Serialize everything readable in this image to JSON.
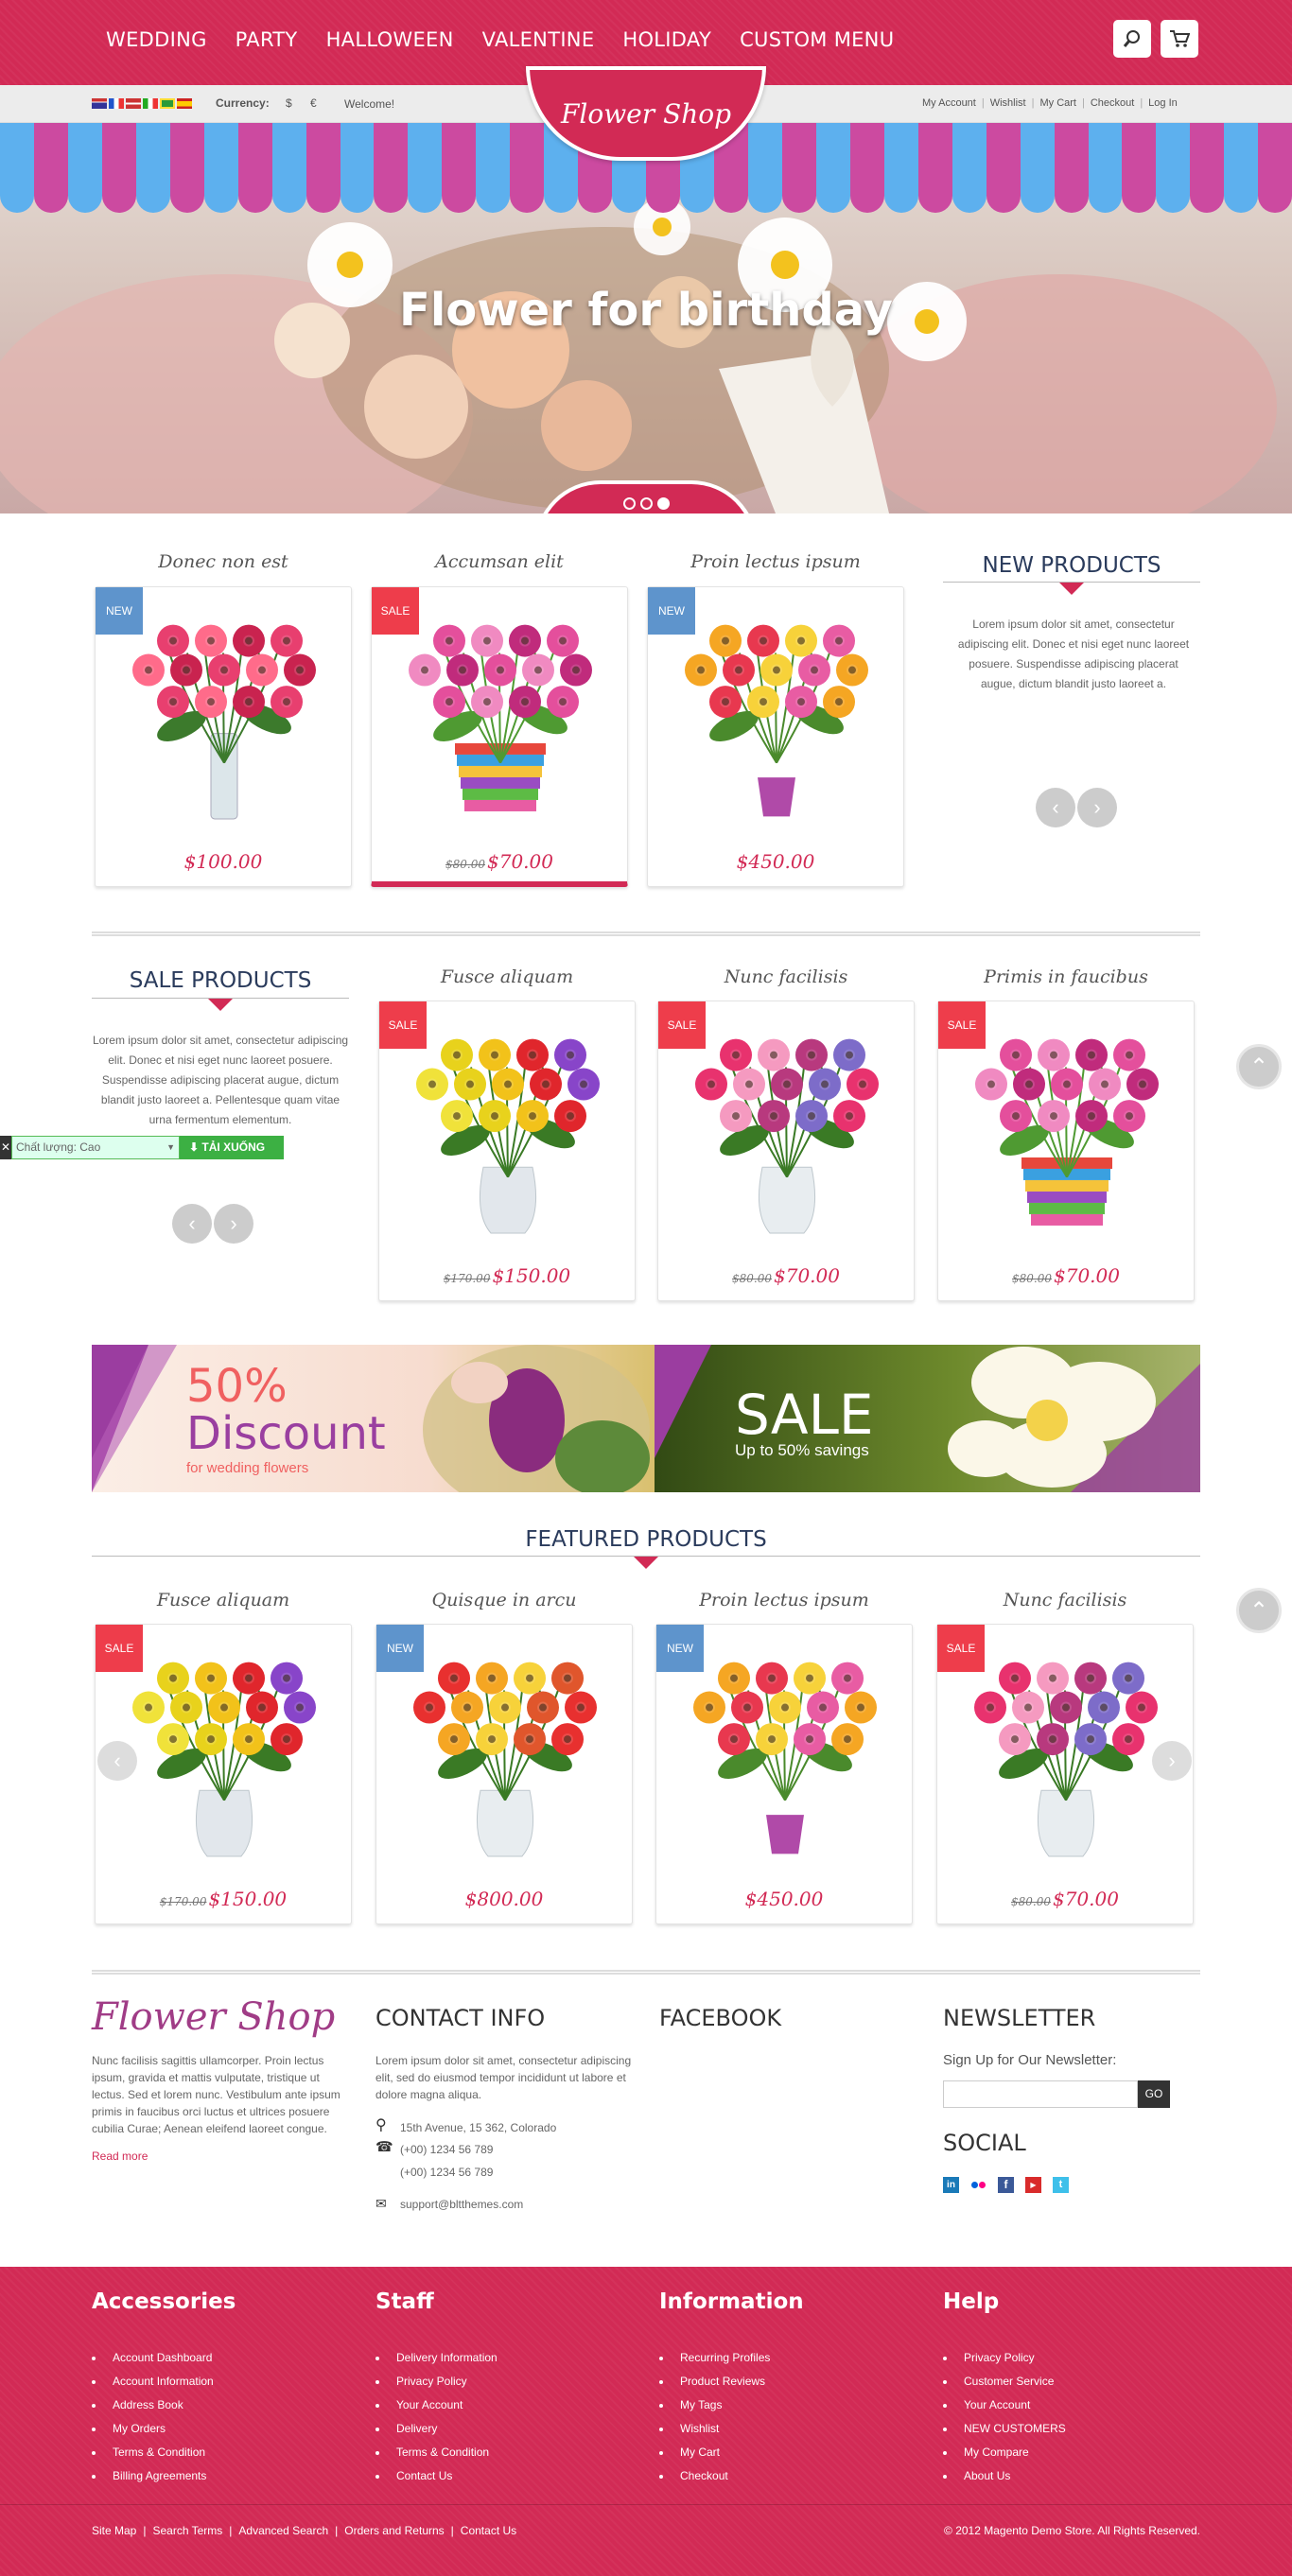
{
  "nav": {
    "menu": [
      "WEDDING",
      "PARTY",
      "HALLOWEEN",
      "VALENTINE",
      "HOLIDAY",
      "CUSTOM MENU"
    ]
  },
  "subbar": {
    "currency_label": "Currency:",
    "currencies": [
      "$",
      "€"
    ],
    "welcome": "Welcome!",
    "links": [
      "My Account",
      "Wishlist",
      "My Cart",
      "Checkout",
      "Log In"
    ]
  },
  "logo": "Flower Shop",
  "hero": {
    "title": "Flower for birthday"
  },
  "new_products": {
    "title": "NEW PRODUCTS",
    "text": "Lorem ipsum dolor sit amet, consectetur adipiscing elit. Donec et nisi eget nunc laoreet posuere. Suspendisse adipiscing placerat augue, dictum blandit justo laoreet a.",
    "items": [
      {
        "name": "Donec non est",
        "tag": "NEW",
        "price": "$100.00",
        "old": ""
      },
      {
        "name": "Accumsan elit",
        "tag": "SALE",
        "price": "$70.00",
        "old": "$80.00"
      },
      {
        "name": "Proin lectus ipsum",
        "tag": "NEW",
        "price": "$450.00",
        "old": ""
      }
    ]
  },
  "sale_products": {
    "title": "SALE PRODUCTS",
    "text": "Lorem ipsum dolor sit amet, consectetur adipiscing elit. Donec et nisi eget nunc laoreet posuere. Suspendisse adipiscing placerat augue, dictum blandit justo laoreet a. Pellentesque quam vitae urna fermentum elementum.",
    "items": [
      {
        "name": "Fusce aliquam",
        "tag": "SALE",
        "price": "$150.00",
        "old": "$170.00"
      },
      {
        "name": "Nunc facilisis",
        "tag": "SALE",
        "price": "$70.00",
        "old": "$80.00"
      },
      {
        "name": "Primis in faucibus",
        "tag": "SALE",
        "price": "$70.00",
        "old": "$80.00"
      }
    ]
  },
  "download_widget": {
    "quality": "Chất lượng: Cao",
    "button": "TẢI XUỐNG"
  },
  "banner": {
    "left_big": "50%",
    "left_word": "Discount",
    "left_small": "for wedding flowers",
    "right_big": "SALE",
    "right_small": "Up to 50% savings"
  },
  "featured": {
    "title": "FEATURED PRODUCTS",
    "items": [
      {
        "name": "Fusce aliquam",
        "tag": "SALE",
        "price": "$150.00",
        "old": "$170.00"
      },
      {
        "name": "Quisque in arcu",
        "tag": "NEW",
        "price": "$800.00",
        "old": ""
      },
      {
        "name": "Proin lectus ipsum",
        "tag": "NEW",
        "price": "$450.00",
        "old": ""
      },
      {
        "name": "Nunc facilisis",
        "tag": "SALE",
        "price": "$70.00",
        "old": "$80.00"
      }
    ]
  },
  "footer_top": {
    "about": "Nunc facilisis sagittis ullamcorper. Proin lectus ipsum, gravida et mattis vulputate, tristique ut lectus. Sed et lorem nunc. Vestibulum ante ipsum primis in faucibus orci luctus et ultrices posuere cubilia Curae; Aenean eleifend laoreet congue.",
    "read_more": "Read more",
    "contact_title": "CONTACT INFO",
    "contact_text": "Lorem ipsum dolor sit amet, consectetur adipiscing elit, sed do eiusmod tempor incididunt ut labore et dolore magna aliqua.",
    "address": "15th Avenue, 15 362, Colorado",
    "phone1": "(+00) 1234 56 789",
    "phone2": "(+00) 1234 56 789",
    "email": "support@bltthemes.com",
    "facebook_title": "FACEBOOK",
    "newsletter_title": "NEWSLETTER",
    "newsletter_label": "Sign Up for Our Newsletter:",
    "go": "GO",
    "social_title": "SOCIAL"
  },
  "footer": {
    "cols": [
      {
        "title": "Accessories",
        "items": [
          "Account Dashboard",
          "Account Information",
          "Address Book",
          "My Orders",
          "Terms & Condition",
          "Billing Agreements"
        ]
      },
      {
        "title": "Staff",
        "items": [
          "Delivery Information",
          "Privacy Policy",
          "Your Account",
          "Delivery",
          "Terms & Condition",
          "Contact Us"
        ]
      },
      {
        "title": "Information",
        "items": [
          "Recurring Profiles",
          "Product Reviews",
          "My Tags",
          "Wishlist",
          "My Cart",
          "Checkout"
        ]
      },
      {
        "title": "Help",
        "items": [
          "Privacy Policy",
          "Customer Service",
          "Your Account",
          "NEW CUSTOMERS",
          "My Compare",
          "About Us"
        ]
      }
    ],
    "bottom_links": [
      "Site Map",
      "Search Terms",
      "Advanced Search",
      "Orders and Returns",
      "Contact Us"
    ],
    "copyright": "© 2012 Magento Demo Store. All Rights Reserved."
  },
  "colors": {
    "brand": "#d22a55",
    "new_tag": "#5e94cc",
    "sale_tag": "#ee3d4b",
    "heading": "#2a3b5c"
  }
}
